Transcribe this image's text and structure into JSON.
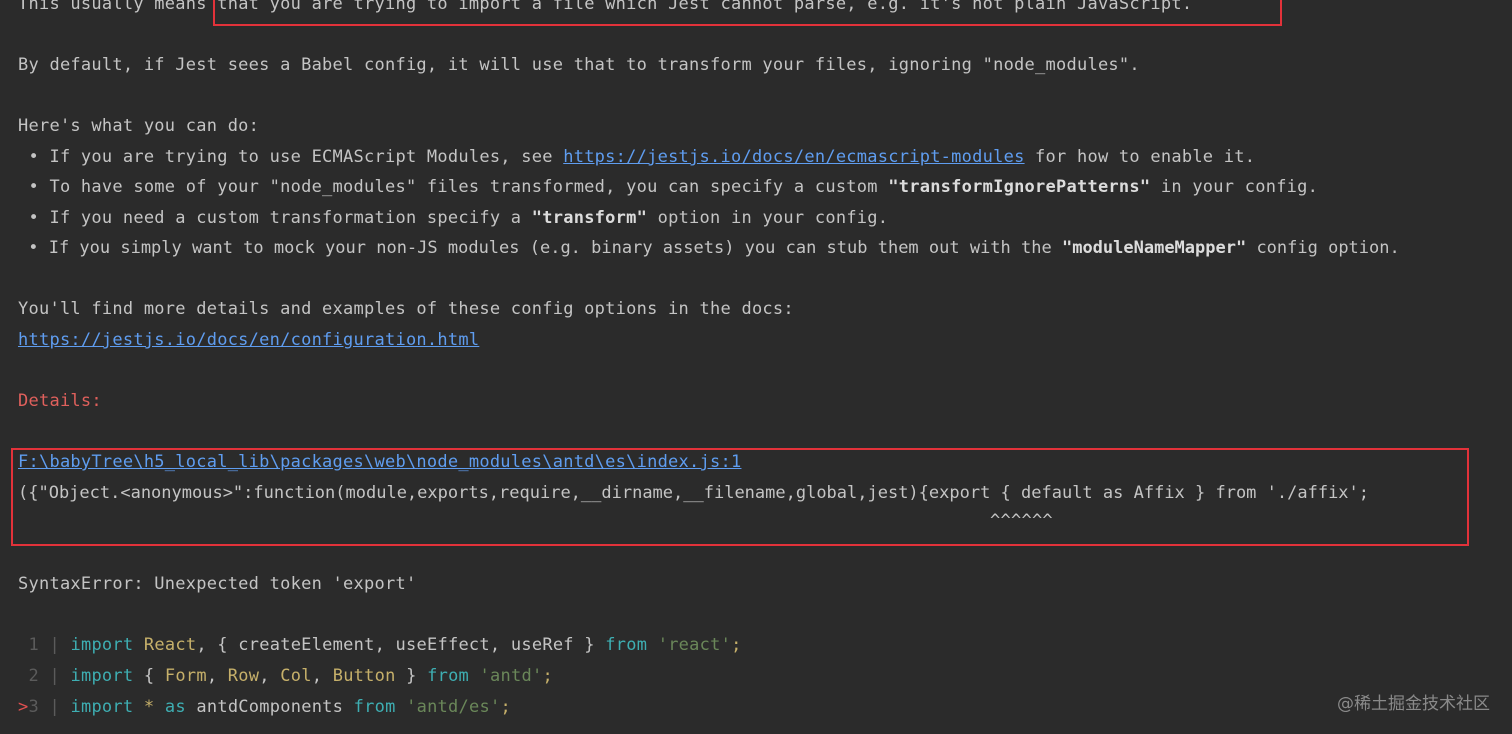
{
  "intro_line": {
    "prefix": "This usually means",
    "rest": " that you are trying to import a file which Jest cannot parse, e.g. it's not plain JavaScript."
  },
  "babel_line": "By default, if Jest sees a Babel config, it will use that to transform your files, ignoring \"node_modules\".",
  "todo_heading": "Here's what you can do:",
  "bullets": [
    {
      "before": " • If you are trying to use ECMAScript Modules, see ",
      "link": "https://jestjs.io/docs/en/ecmascript-modules",
      "after": " for how to enable it."
    },
    {
      "before": " • To have some of your \"node_modules\" files transformed, you can specify a custom ",
      "bold": "\"transformIgnorePatterns\"",
      "after": " in your config."
    },
    {
      "before": " • If you need a custom transformation specify a ",
      "bold": "\"transform\"",
      "after": " option in your config."
    },
    {
      "before": " • If you simply want to mock your non-JS modules (e.g. binary assets) you can stub them out with the ",
      "bold": "\"moduleNameMapper\"",
      "after": " config option."
    }
  ],
  "docs_line": "You'll find more details and examples of these config options in the docs:",
  "docs_link": "https://jestjs.io/docs/en/configuration.html",
  "details_label": "Details:",
  "error_location": "F:\\babyTree\\h5_local_lib\\packages\\web\\node_modules\\antd\\es\\index.js:1",
  "error_source": "({\"Object.<anonymous>\":function(module,exports,require,__dirname,__filename,global,jest){export { default as Affix } from './affix';",
  "error_caret": "^^^^^^",
  "syntax_error": "SyntaxError: Unexpected token 'export'",
  "code_lines": [
    {
      "marker": " ",
      "num": "1",
      "sep": " | ",
      "tokens": [
        {
          "t": "import",
          "c": "kw2"
        },
        {
          "t": " ",
          "c": ""
        },
        {
          "t": "React",
          "c": "ident-y"
        },
        {
          "t": ", { createElement, useEffect, useRef } ",
          "c": ""
        },
        {
          "t": "from",
          "c": "kw2"
        },
        {
          "t": " ",
          "c": ""
        },
        {
          "t": "'react'",
          "c": "str"
        },
        {
          "t": ";",
          "c": "ident-y"
        }
      ]
    },
    {
      "marker": " ",
      "num": "2",
      "sep": " | ",
      "tokens": [
        {
          "t": "import",
          "c": "kw2"
        },
        {
          "t": " { ",
          "c": ""
        },
        {
          "t": "Form",
          "c": "ident-y"
        },
        {
          "t": ", ",
          "c": ""
        },
        {
          "t": "Row",
          "c": "ident-y"
        },
        {
          "t": ", ",
          "c": ""
        },
        {
          "t": "Col",
          "c": "ident-y"
        },
        {
          "t": ", ",
          "c": ""
        },
        {
          "t": "Button",
          "c": "ident-y"
        },
        {
          "t": " } ",
          "c": ""
        },
        {
          "t": "from",
          "c": "kw2"
        },
        {
          "t": " ",
          "c": ""
        },
        {
          "t": "'antd'",
          "c": "str"
        },
        {
          "t": ";",
          "c": "ident-y"
        }
      ]
    },
    {
      "marker": ">",
      "num": "3",
      "sep": " | ",
      "tokens": [
        {
          "t": "import",
          "c": "kw2"
        },
        {
          "t": " ",
          "c": ""
        },
        {
          "t": "*",
          "c": "ident-y"
        },
        {
          "t": " ",
          "c": ""
        },
        {
          "t": "as",
          "c": "kw2"
        },
        {
          "t": " antdComponents ",
          "c": ""
        },
        {
          "t": "from",
          "c": "kw2"
        },
        {
          "t": " ",
          "c": ""
        },
        {
          "t": "'antd/es'",
          "c": "str"
        },
        {
          "t": ";",
          "c": "ident-y"
        }
      ]
    }
  ],
  "watermark": "@稀土掘金技术社区",
  "colors": {
    "background": "#2b2b2b",
    "text": "#c4c4c4",
    "link": "#5f9df0",
    "details": "#e0605c",
    "highlight_box": "#e2323a",
    "keyword": "#3eaeb2",
    "identifier": "#c6b06a",
    "string": "#6a8759"
  }
}
